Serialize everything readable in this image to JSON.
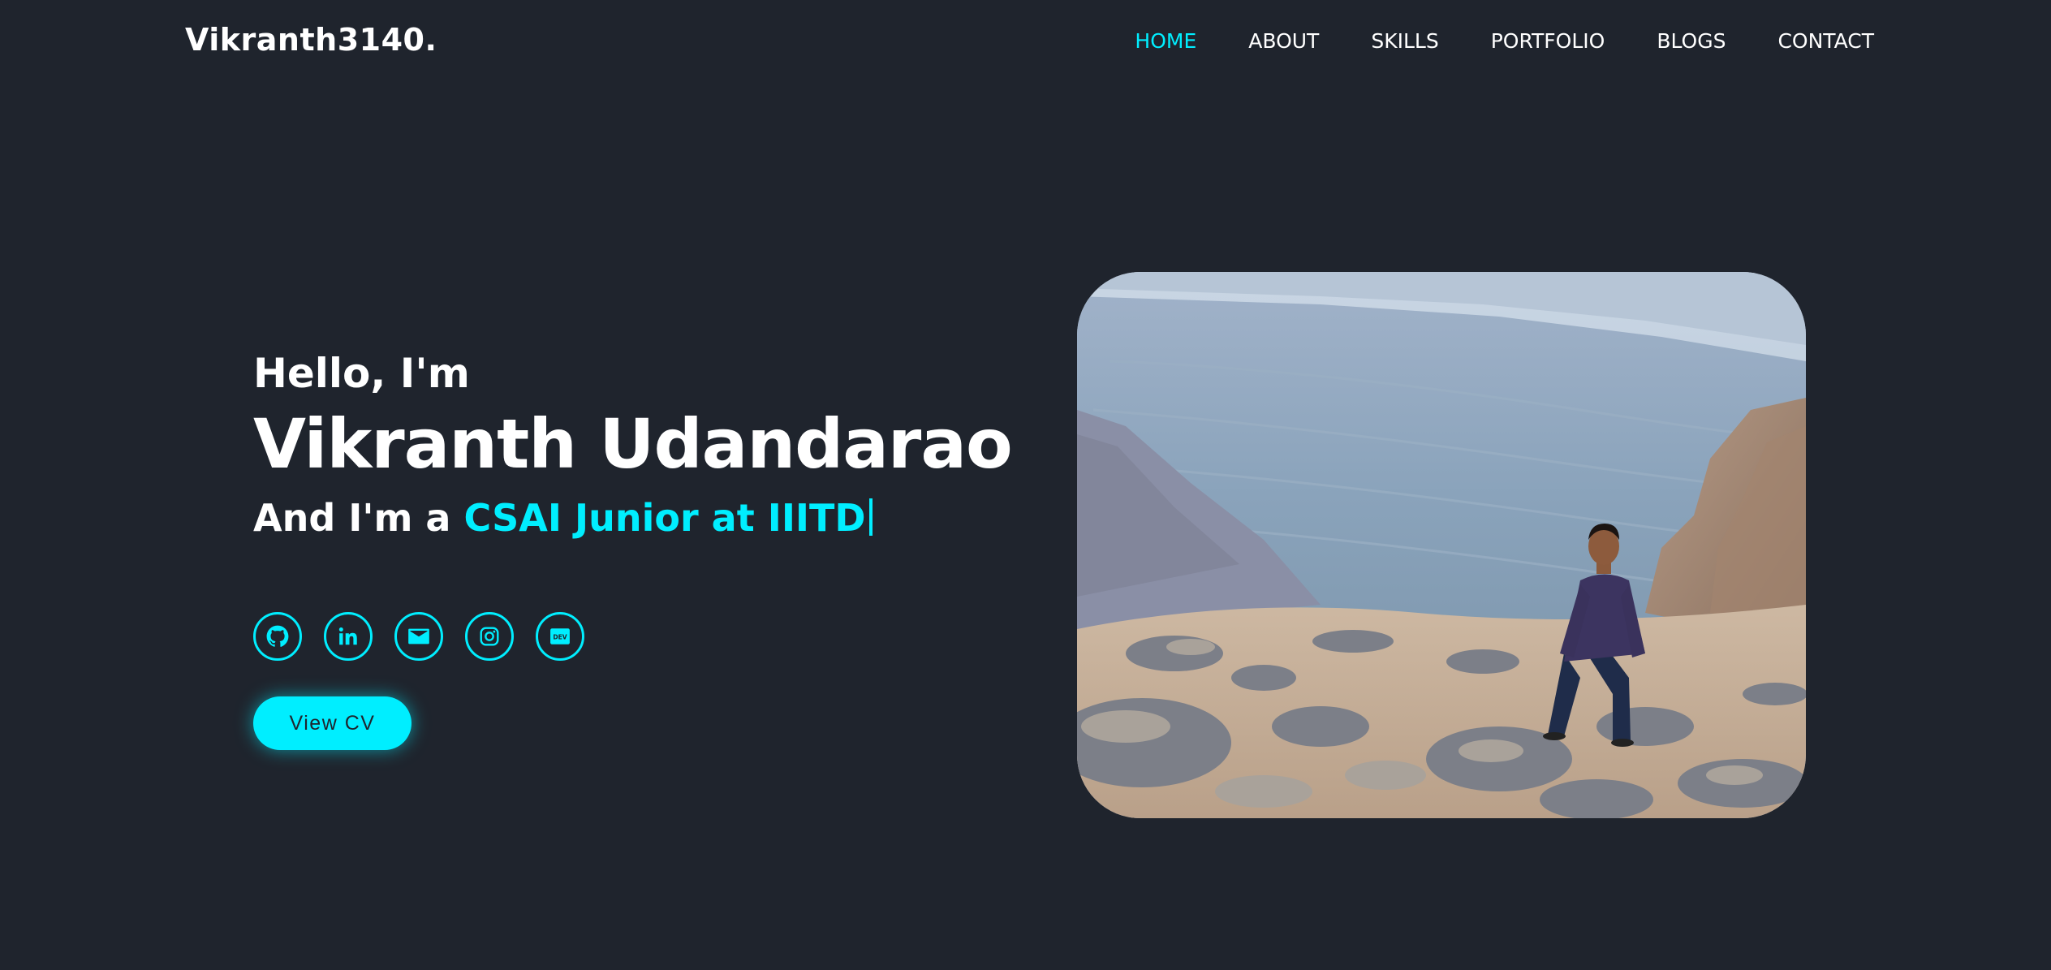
{
  "header": {
    "logo": "Vikranth3140.",
    "nav": [
      {
        "label": "HOME",
        "active": true
      },
      {
        "label": "ABOUT",
        "active": false
      },
      {
        "label": "SKILLS",
        "active": false
      },
      {
        "label": "PORTFOLIO",
        "active": false
      },
      {
        "label": "BLOGS",
        "active": false
      },
      {
        "label": "CONTACT",
        "active": false
      }
    ]
  },
  "hero": {
    "greeting": "Hello, I'm",
    "name": "Vikranth Udandarao",
    "role_prefix": "And I'm a ",
    "role_highlight": "CSAI Junior at IIITD",
    "socials": [
      {
        "icon": "github-icon"
      },
      {
        "icon": "linkedin-icon"
      },
      {
        "icon": "mail-icon"
      },
      {
        "icon": "instagram-icon"
      },
      {
        "icon": "dev-icon",
        "text": "DEV"
      }
    ],
    "cv_button": "View CV"
  },
  "colors": {
    "background": "#1f242d",
    "accent": "#00eeff",
    "text": "#ffffff"
  }
}
